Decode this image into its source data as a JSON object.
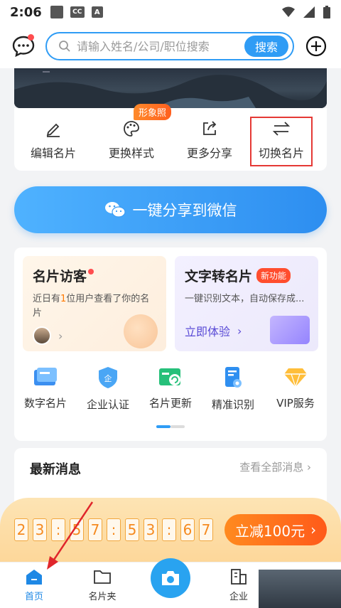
{
  "statusbar": {
    "time": "2:06",
    "cc": "CC",
    "a": "A"
  },
  "search": {
    "placeholder": "请输入姓名/公司/职位搜索",
    "button_label": "搜索"
  },
  "actions": [
    {
      "label": "编辑名片"
    },
    {
      "label": "更换样式",
      "badge": "形象照"
    },
    {
      "label": "更多分享"
    },
    {
      "label": "切换名片"
    }
  ],
  "share_button": {
    "label": "一键分享到微信"
  },
  "promos": {
    "visitors": {
      "title": "名片访客",
      "desc_prefix": "近日有",
      "count": "1",
      "desc_suffix": "位用户查看了你的名片"
    },
    "text_to_card": {
      "title": "文字转名片",
      "badge": "新功能",
      "desc": "一键识别文本，自动保存成...",
      "link": "立即体验"
    }
  },
  "feature_icons": [
    {
      "label": "数字名片"
    },
    {
      "label": "企业认证"
    },
    {
      "label": "名片更新"
    },
    {
      "label": "精准识别"
    },
    {
      "label": "VIP服务"
    }
  ],
  "news": {
    "title": "最新消息",
    "more": "查看全部消息"
  },
  "countdown": {
    "digits": [
      "2",
      "3",
      ":",
      "5",
      "7",
      ":",
      "5",
      "3",
      ":",
      "6",
      "7"
    ],
    "button": "立减100元"
  },
  "tabs": [
    {
      "label": "首页"
    },
    {
      "label": "名片夹"
    },
    {
      "label": ""
    },
    {
      "label": "企业"
    }
  ],
  "colors": {
    "accent": "#2f9cf5",
    "highlight_box": "#e53935",
    "orange": "#ff6a1a"
  }
}
